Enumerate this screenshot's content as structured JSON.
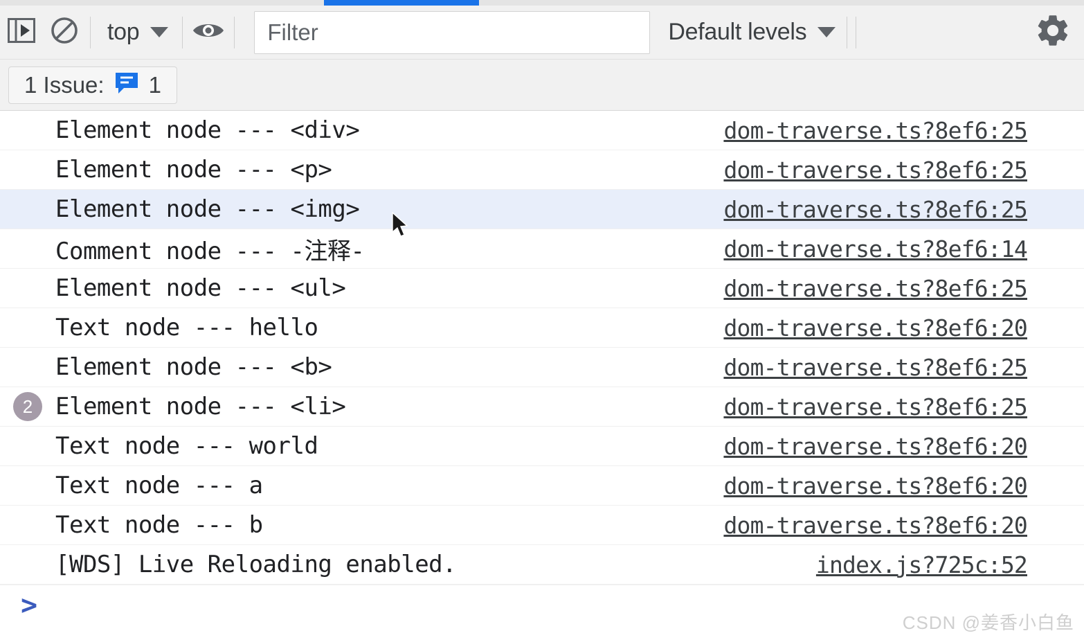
{
  "window": {
    "title": "DevTools Console",
    "active_tab_accent": "#1a73e8"
  },
  "toolbar": {
    "sidebar_toggle_icon": "console-sidebar-icon",
    "clear_console_icon": "clear-console-icon",
    "context_selector": {
      "label": "top",
      "caret_icon": "chevron-down-icon"
    },
    "live_expression_icon": "eye-icon",
    "filter": {
      "placeholder": "Filter",
      "value": ""
    },
    "log_levels": {
      "label": "Default levels",
      "caret_icon": "chevron-down-icon"
    },
    "settings_icon": "gear-icon"
  },
  "issues_bar": {
    "label": "1 Issue:",
    "issue_icon": "issue-message-icon",
    "issue_icon_color": "#1a73e8",
    "count": "1"
  },
  "console": {
    "messages": [
      {
        "badge": "",
        "text": "Element node --- <div>",
        "source": "dom-traverse.ts?8ef6:25",
        "selected": false
      },
      {
        "badge": "",
        "text": "Element node --- <p>",
        "source": "dom-traverse.ts?8ef6:25",
        "selected": false
      },
      {
        "badge": "",
        "text": "Element node --- <img>",
        "source": "dom-traverse.ts?8ef6:25",
        "selected": true
      },
      {
        "badge": "",
        "text": "Comment node --- -注释-",
        "source": "dom-traverse.ts?8ef6:14",
        "selected": false
      },
      {
        "badge": "",
        "text": "Element node --- <ul>",
        "source": "dom-traverse.ts?8ef6:25",
        "selected": false
      },
      {
        "badge": "",
        "text": "Text node --- hello",
        "source": "dom-traverse.ts?8ef6:20",
        "selected": false
      },
      {
        "badge": "",
        "text": "Element node --- <b>",
        "source": "dom-traverse.ts?8ef6:25",
        "selected": false
      },
      {
        "badge": "2",
        "text": "Element node --- <li>",
        "source": "dom-traverse.ts?8ef6:25",
        "selected": false
      },
      {
        "badge": "",
        "text": "Text node --- world",
        "source": "dom-traverse.ts?8ef6:20",
        "selected": false
      },
      {
        "badge": "",
        "text": "Text node --- a",
        "source": "dom-traverse.ts?8ef6:20",
        "selected": false
      },
      {
        "badge": "",
        "text": "Text node --- b",
        "source": "dom-traverse.ts?8ef6:20",
        "selected": false
      },
      {
        "badge": "",
        "text": "[WDS] Live Reloading enabled.",
        "source": "index.js?725c:52",
        "selected": false
      }
    ],
    "selected_row_color": "#e8eefa",
    "repeat_badge_color": "#a59ba8"
  },
  "prompt": {
    "chevron": ">",
    "value": "",
    "chevron_color": "#3b5bbd"
  },
  "watermark": {
    "text": "CSDN @姜香小白鱼"
  }
}
